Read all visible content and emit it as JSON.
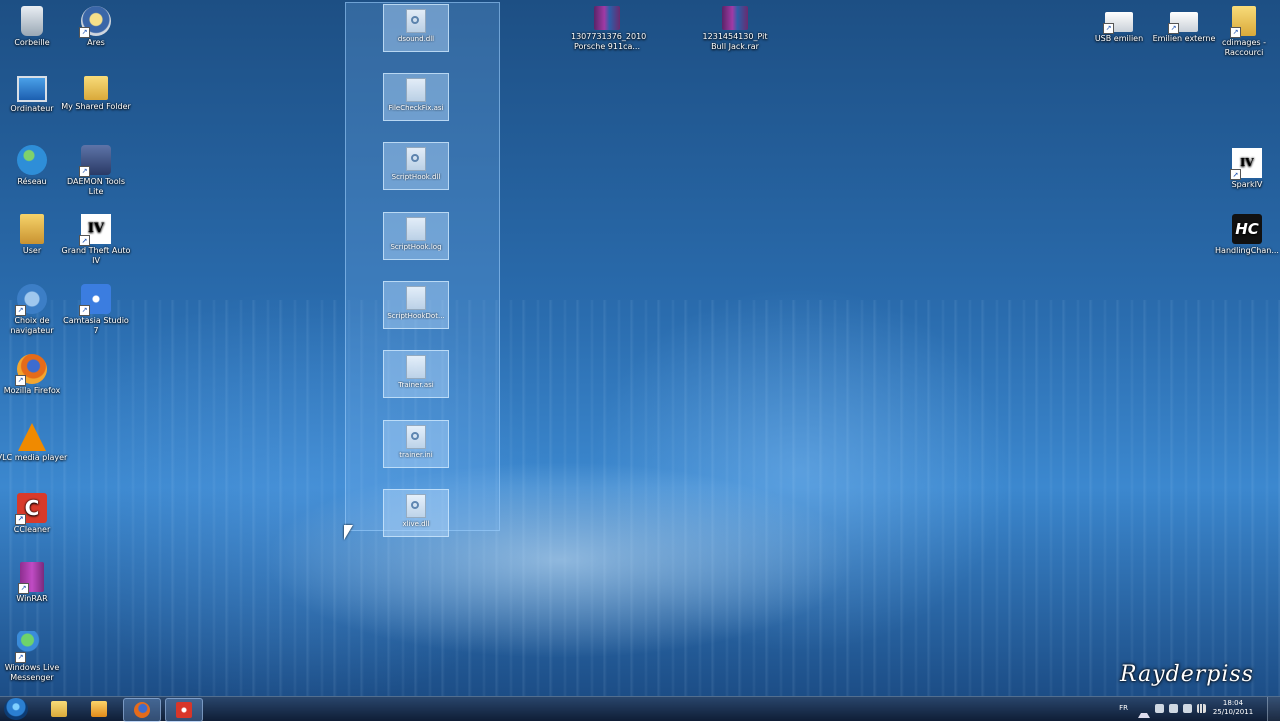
{
  "desktop_left_col1": [
    {
      "label": "Corbeille",
      "icon": "recycle-bin-icon"
    },
    {
      "label": "Ordinateur",
      "icon": "computer-icon"
    },
    {
      "label": "Réseau",
      "icon": "network-icon"
    },
    {
      "label": "User",
      "icon": "user-folder-icon"
    },
    {
      "label": "Choix de navigateur",
      "icon": "browser-choice-icon"
    },
    {
      "label": "Mozilla Firefox",
      "icon": "firefox-icon"
    },
    {
      "label": "VLC media player",
      "icon": "vlc-icon"
    },
    {
      "label": "CCleaner",
      "icon": "ccleaner-icon"
    },
    {
      "label": "WinRAR",
      "icon": "winrar-icon"
    },
    {
      "label": "Windows Live Messenger",
      "icon": "messenger-icon"
    }
  ],
  "desktop_left_col2": [
    {
      "label": "Ares",
      "icon": "ares-icon"
    },
    {
      "label": "My Shared Folder",
      "icon": "folder-icon"
    },
    {
      "label": "DAEMON Tools Lite",
      "icon": "daemon-tools-icon"
    },
    {
      "label": "Grand Theft Auto IV",
      "icon": "gta-icon",
      "glyph_text": "IV"
    },
    {
      "label": "Camtasia Studio 7",
      "icon": "camtasia-icon"
    }
  ],
  "desktop_top_files": [
    {
      "label": "1307731376_2010 Porsche 911ca...",
      "icon": "rar-archive-icon"
    },
    {
      "label": "1231454130_Pit Bull Jack.rar",
      "icon": "rar-archive-icon"
    }
  ],
  "desktop_right": [
    {
      "label": "USB emilien",
      "icon": "usb-drive-icon"
    },
    {
      "label": "Emilien externe",
      "icon": "external-drive-icon"
    },
    {
      "label": "cdimages - Raccourci",
      "icon": "folder-shortcut-icon"
    },
    {
      "label": "SparkIV",
      "icon": "sparkiv-icon",
      "glyph_text": "IV"
    },
    {
      "label": "HandlingChan...",
      "icon": "hc-icon",
      "glyph_text": "HC"
    }
  ],
  "selected_files": [
    {
      "label": "dsound.dll",
      "icon": "dll-file-icon"
    },
    {
      "label": "FileCheckFix.asi",
      "icon": "generic-file-icon"
    },
    {
      "label": "ScriptHook.dll",
      "icon": "dll-file-icon"
    },
    {
      "label": "ScriptHook.log",
      "icon": "generic-file-icon"
    },
    {
      "label": "ScriptHookDot...",
      "icon": "generic-file-icon"
    },
    {
      "label": "Trainer.asi",
      "icon": "generic-file-icon"
    },
    {
      "label": "trainer.ini",
      "icon": "ini-file-icon"
    },
    {
      "label": "xlive.dll",
      "icon": "dll-file-icon"
    }
  ],
  "shortcut_glyph": "↗",
  "watermark": "Rayderpiss",
  "taskbar": {
    "language": "FR",
    "time": "18:04",
    "date": "25/10/2011",
    "pinned": [
      "start-button",
      "explorer",
      "media-player",
      "firefox",
      "camtasia"
    ]
  },
  "colors": {
    "desktop_base": "#2a6cae",
    "selection": "#78b4f0",
    "taskbar": "#0a1932"
  }
}
